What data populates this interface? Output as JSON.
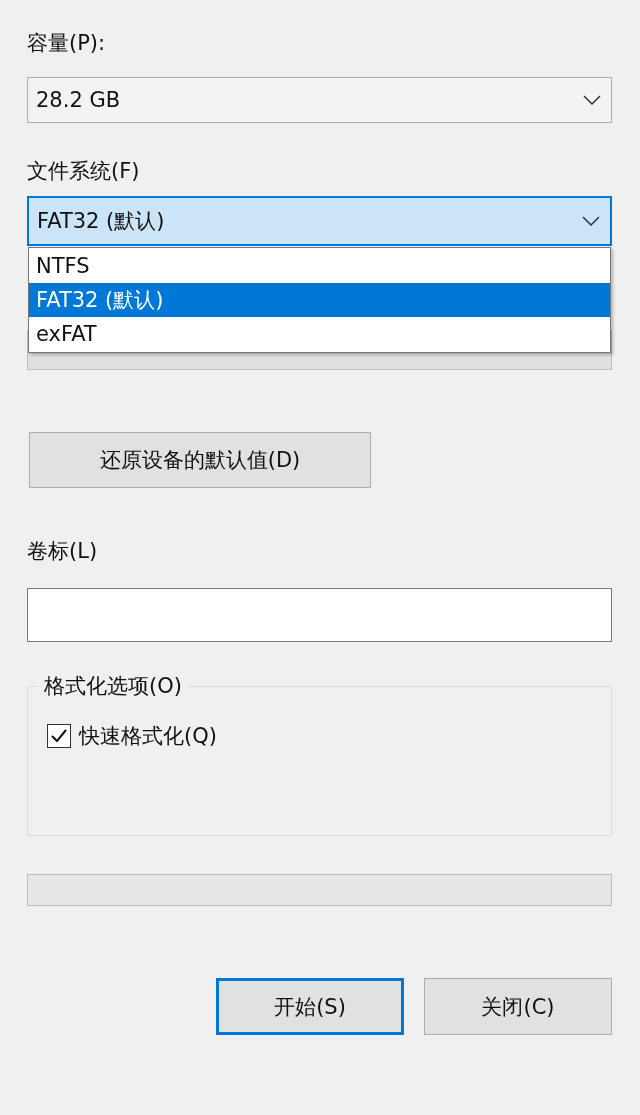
{
  "capacity": {
    "label": "容量(P):",
    "value": "28.2 GB"
  },
  "file_system": {
    "label": "文件系统(F)",
    "value": "FAT32 (默认)",
    "expanded": true,
    "options": [
      {
        "label": "NTFS",
        "selected": false
      },
      {
        "label": "FAT32 (默认)",
        "selected": true
      },
      {
        "label": "exFAT",
        "selected": false
      }
    ]
  },
  "restore_button": {
    "label": "还原设备的默认值(D)"
  },
  "volume_label": {
    "label": "卷标(L)"
  },
  "format_options": {
    "title": "格式化选项(O)",
    "quick_format": {
      "label": "快速格式化(Q)",
      "checked": true
    }
  },
  "progress": {
    "level": 0
  },
  "buttons": [
    {
      "label": "开始(S)",
      "default": true
    },
    {
      "label": "关闭(C)",
      "default": false
    }
  ]
}
